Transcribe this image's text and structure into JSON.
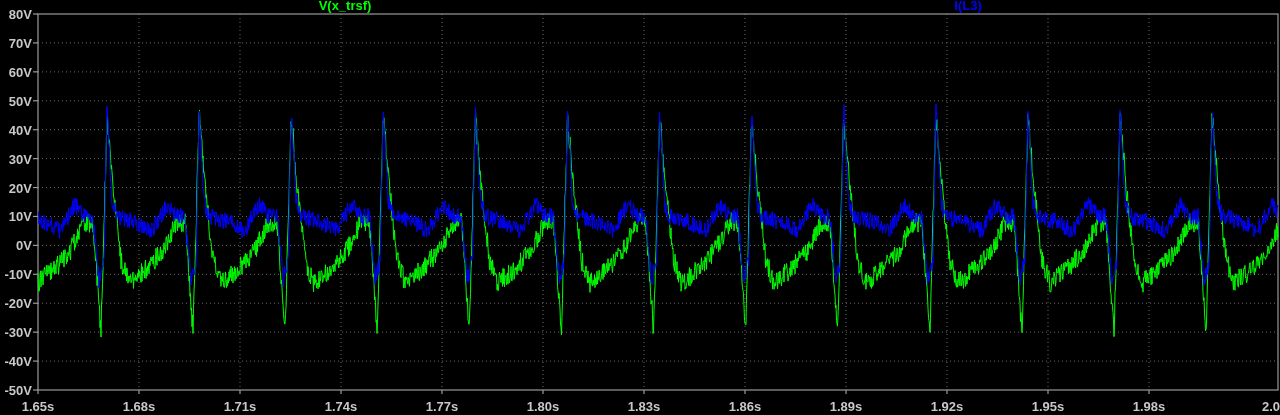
{
  "traces": [
    {
      "label": "V(x_trsf)",
      "color": "#00ff00"
    },
    {
      "label": "I(L3)",
      "color": "#0000ff"
    }
  ],
  "y_axis": {
    "ticks": [
      "80V",
      "70V",
      "60V",
      "50V",
      "40V",
      "30V",
      "20V",
      "10V",
      "0V",
      "-10V",
      "-20V",
      "-30V",
      "-40V",
      "-50V"
    ]
  },
  "x_axis": {
    "ticks": [
      "1.65s",
      "1.68s",
      "1.71s",
      "1.74s",
      "1.77s",
      "1.80s",
      "1.83s",
      "1.86s",
      "1.89s",
      "1.92s",
      "1.95s",
      "1.98s",
      "2.0"
    ]
  }
}
